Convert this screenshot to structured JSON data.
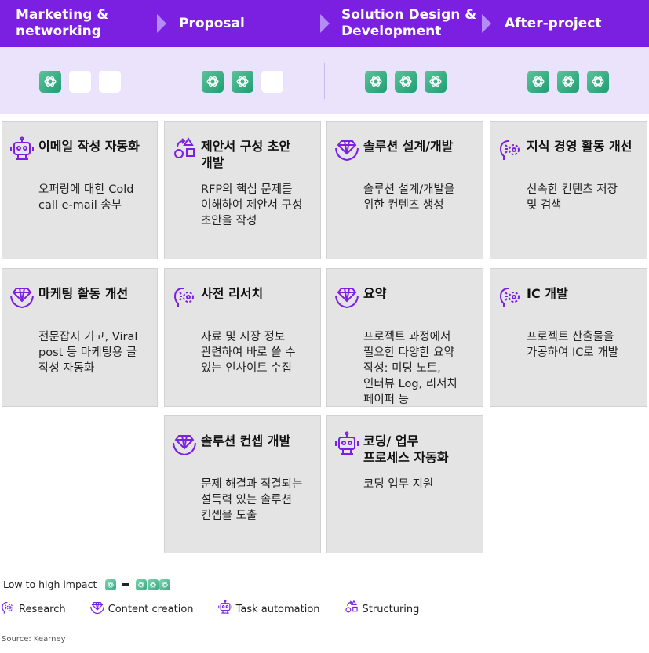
{
  "header": {
    "phases": [
      "Marketing &\nnetworking",
      "Proposal",
      "Solution Design &\nDevelopment",
      "After-project"
    ]
  },
  "impact_levels": [
    1,
    2,
    3,
    3
  ],
  "cards": [
    {
      "type": "task-automation",
      "title": "이메일 작성 자동화",
      "body": "오퍼링에 대한 Cold\ncall e-mail 송부"
    },
    {
      "type": "structuring",
      "title": "제안서 구성 초안\n개발",
      "body": "RFP의 핵심 문제를\n이해하여 제안서 구성\n초안을 작성"
    },
    {
      "type": "content-creation",
      "title": "솔루션 설계/개발",
      "body": "솔루션 설계/개발을\n위한 컨텐츠 생성"
    },
    {
      "type": "research",
      "title": "지식 경영 활동 개선",
      "body": "신속한 컨텐츠 저장\n및 검색"
    },
    {
      "type": "content-creation",
      "title": "마케팅 활동 개선",
      "body": "전문잡지 기고, Viral\npost 등 마케팅용 글\n작성 자동화"
    },
    {
      "type": "research",
      "title": "사전 리서치",
      "body": "자료 및 시장 정보\n관련하여 바로 쓸 수\n있는 인사이트 수집"
    },
    {
      "type": "content-creation",
      "title": "요약",
      "body": "프로젝트 과정에서\n필요한 다양한 요약\n작성: 미팅 노트,\n인터뷰 Log, 리서치\n페이퍼 등"
    },
    {
      "type": "research",
      "title": "IC 개발",
      "body": "프로젝트 산출물을\n가공하여 IC로 개발"
    },
    {
      "type": "content-creation",
      "title": "솔루션 컨셉 개발",
      "body": "문제 해결과 직결되는\n설득력 있는 솔루션\n컨셉을 도출"
    },
    {
      "type": "task-automation",
      "title": "코딩/ 업무\n프로세스 자동화",
      "body": "코딩 업무 지원"
    }
  ],
  "legend": {
    "impact_label": "Low to high impact",
    "types": [
      {
        "key": "research",
        "label": "Research"
      },
      {
        "key": "content-creation",
        "label": "Content creation"
      },
      {
        "key": "task-automation",
        "label": "Task automation"
      },
      {
        "key": "structuring",
        "label": "Structuring"
      }
    ]
  },
  "source": "Source: Kearney",
  "colors": {
    "header": "#7b1fe0",
    "band": "#ebe3fb",
    "card": "#e4e4e4",
    "icon": "#7b1fe0",
    "impact": "#2fa57c"
  }
}
